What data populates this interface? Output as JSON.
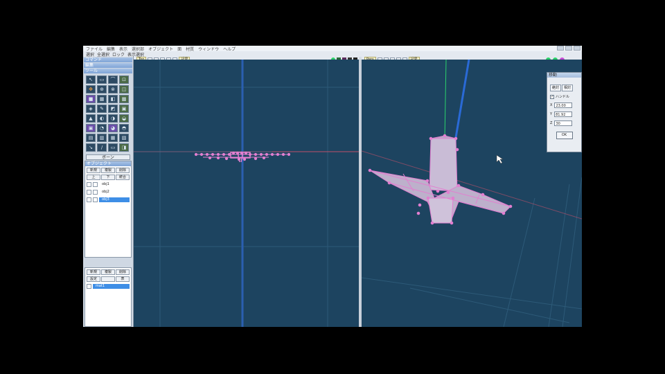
{
  "menubar": {
    "items": [
      "ファイル",
      "編集",
      "表示",
      "選択部",
      "オブジェクト",
      "面",
      "材質",
      "ウィンドウ",
      "ヘルプ"
    ],
    "title_right": [
      "",
      ""
    ]
  },
  "toolbar2": {
    "items": [
      "選択",
      "全選択",
      "ロック",
      "表示選択"
    ]
  },
  "left_panel": {
    "sections": [
      "コマンド",
      "編集",
      "ツール"
    ],
    "tools": [
      "↖",
      "▭",
      "⌒",
      "⊡",
      "✥",
      "⊕",
      "⊗",
      "◫",
      "■",
      "▦",
      "◧",
      "▩",
      "◈",
      "✎",
      "◩",
      "▣",
      "▲",
      "◐",
      "◑",
      "◒",
      "▣",
      "◔",
      "◕",
      "◓",
      "▤",
      "▥",
      "▦",
      "▧",
      "↘",
      "/",
      "▭",
      "◨"
    ],
    "bone_button": "ボーン"
  },
  "object_panel": {
    "title": "オブジェクト",
    "tabs": [
      "新規",
      "複製",
      "削除"
    ],
    "tabs2": [
      "上",
      "下",
      "統合"
    ],
    "rows": [
      {
        "name": "obj1",
        "selected": false
      },
      {
        "name": "obj2",
        "selected": false
      },
      {
        "name": "obj3",
        "selected": true
      }
    ]
  },
  "material_panel": {
    "tabs": [
      "新規",
      "複製",
      "削除"
    ],
    "tabs2": [
      "設定",
      "",
      "表"
    ],
    "rows": [
      {
        "name": "mat1",
        "selected": true
      }
    ]
  },
  "viewport_left": {
    "label": "Top",
    "buttons": [
      "+",
      "-",
      "◎",
      "⊞",
      "⊟"
    ],
    "extra": "記号"
  },
  "viewport_right": {
    "label": "Pers",
    "buttons": [
      "+",
      "-",
      "◎",
      "⊞",
      "⊟"
    ],
    "extra": "記号"
  },
  "dialog": {
    "title": "移動",
    "tabs": [
      "絶対",
      "相対"
    ],
    "handle_label": "ハンドル",
    "handle_checked": "✓",
    "fields": [
      {
        "axis": "X",
        "value": "23.00"
      },
      {
        "axis": "Y",
        "value": "81.92"
      },
      {
        "axis": "Z",
        "value": "30"
      }
    ],
    "ok_label": "OK"
  },
  "colors": {
    "viewport_bg": "#1d4460",
    "mesh_pink": "#e27fd0",
    "mesh_fill": "#c9bcd6",
    "axis_green": "#2bd36a",
    "axis_blue": "#2a6ad6",
    "axis_red": "#c0506a"
  }
}
